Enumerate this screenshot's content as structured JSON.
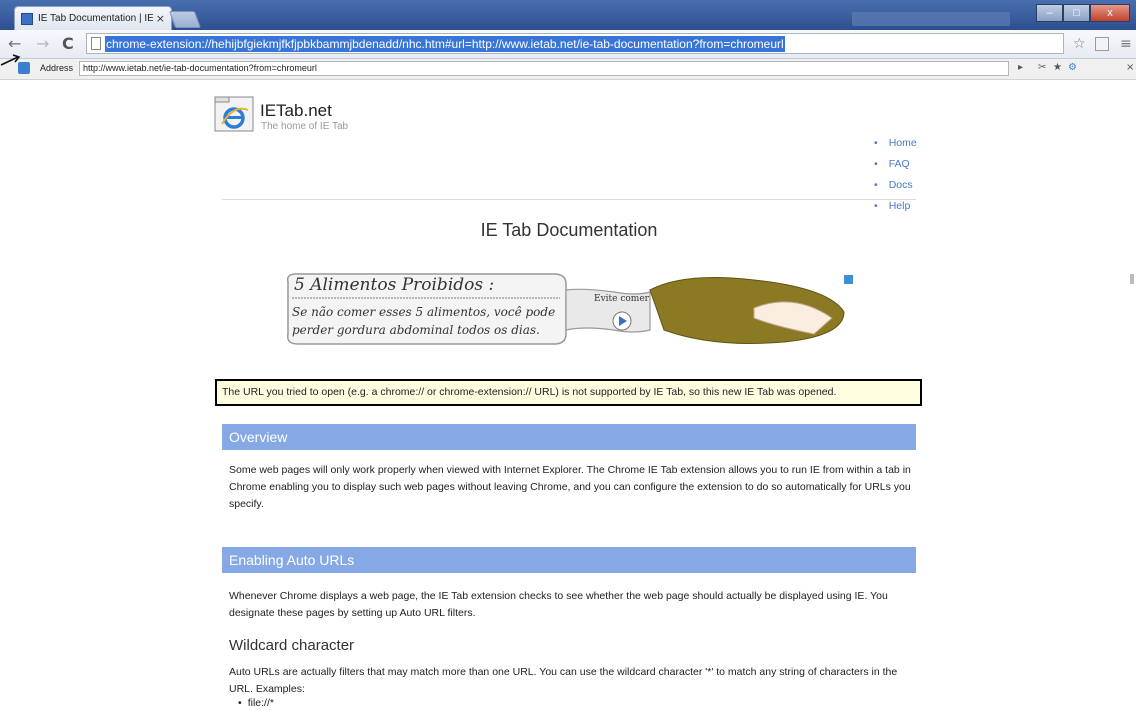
{
  "browser": {
    "tab_title": "IE Tab Documentation | IE",
    "tab_close": "×",
    "url": "chrome-extension://hehijbfgiekmjfkfjpbkbammjbdenadd/nhc.htm#url=http://www.ietab.net/ie-tab-documentation?from=chromeurl",
    "win_min": "–",
    "win_max": "□",
    "win_close": "x"
  },
  "iebar": {
    "label": "Address",
    "url": "http://www.ietab.net/ie-tab-documentation?from=chromeurl"
  },
  "site": {
    "name": "IETab.net",
    "tagline": "The home of IE Tab",
    "nav": [
      "Home",
      "FAQ",
      "Docs",
      "Help"
    ]
  },
  "page": {
    "title": "IE Tab Documentation",
    "notice": "The URL you tried to open (e.g. a chrome:// or chrome-extension:// URL) is not supported by IE Tab, so this new IE Tab was opened.",
    "sections": [
      {
        "heading": "Overview",
        "body": "Some web pages will only work properly when viewed with Internet Explorer. The Chrome IE Tab extension allows you to run IE from within a tab in Chrome enabling you to display such web pages without leaving Chrome, and you can configure the extension to do so automatically for URLs you specify."
      },
      {
        "heading": "Enabling Auto URLs",
        "body": "Whenever Chrome displays a web page, the IE Tab extension checks to see whether the web page should actually be displayed using IE. You designate these pages by setting up Auto URL filters."
      }
    ],
    "subheading": "Wildcard character",
    "wildcard_body": "Auto URLs are actually filters that may match more than one URL. You can use the wildcard character '*' to match any string of characters in the URL. Examples:",
    "bullet": "file://*"
  },
  "ad": {
    "title": "5 Alimentos Proibidos :",
    "line1": "Se não comer esses 5 alimentos, você pode",
    "line2": "perder gordura abdominal todos os dias.",
    "cta": "Evite comer"
  }
}
